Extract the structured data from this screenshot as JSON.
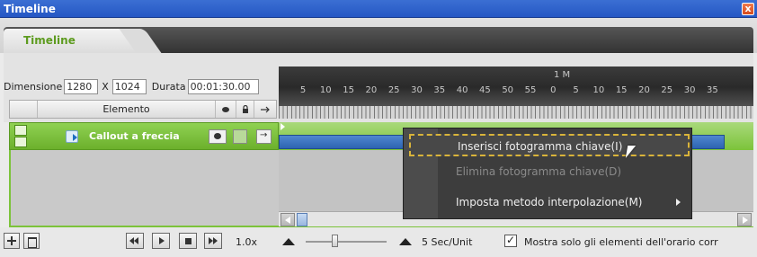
{
  "window": {
    "title": "Timeline",
    "close_glyph": "x"
  },
  "tabs": [
    {
      "label": "Timeline"
    }
  ],
  "dimensions": {
    "label": "Dimensione",
    "width": "1280",
    "separator": "X",
    "height": "1024",
    "duration_label": "Durata",
    "duration": "00:01:30.00"
  },
  "columns": {
    "element": "Elemento"
  },
  "ruler": {
    "minute_label": "1 M",
    "ticks": [
      "5",
      "10",
      "15",
      "20",
      "25",
      "30",
      "35",
      "40",
      "45",
      "50",
      "55",
      "0",
      "5",
      "10",
      "15",
      "20",
      "25",
      "30",
      "35"
    ]
  },
  "track": {
    "element_name": "Callout a freccia"
  },
  "context_menu": {
    "items": [
      {
        "label": "Inserisci fotogramma chiave(I)",
        "state": "highlighted"
      },
      {
        "label": "Elimina fotogramma chiave(D)",
        "state": "disabled"
      },
      {
        "label": "Imposta metodo interpolazione(M)",
        "state": "submenu"
      }
    ]
  },
  "bottom": {
    "speed": "1.0x",
    "unit_label": "5 Sec/Unit",
    "checkbox_label": "Mostra solo gli elementi dell'orario corr",
    "checkbox_checked": true
  },
  "icons": {
    "close": "close-icon",
    "add": "add-icon",
    "delete": "trash-icon",
    "rewind": "rewind-icon",
    "play": "play-icon",
    "stop": "stop-icon",
    "forward": "fast-forward-icon",
    "eye": "eye-icon",
    "lock": "lock-icon",
    "arrow": "arrow-right-icon",
    "element": "callout-arrow-icon"
  },
  "colors": {
    "accent_green": "#7cc33a",
    "title_blue": "#2557c4",
    "key_bar_blue": "#2d64b2",
    "menu_bg": "#3d3d3d",
    "highlight_border": "#d9b43a"
  }
}
